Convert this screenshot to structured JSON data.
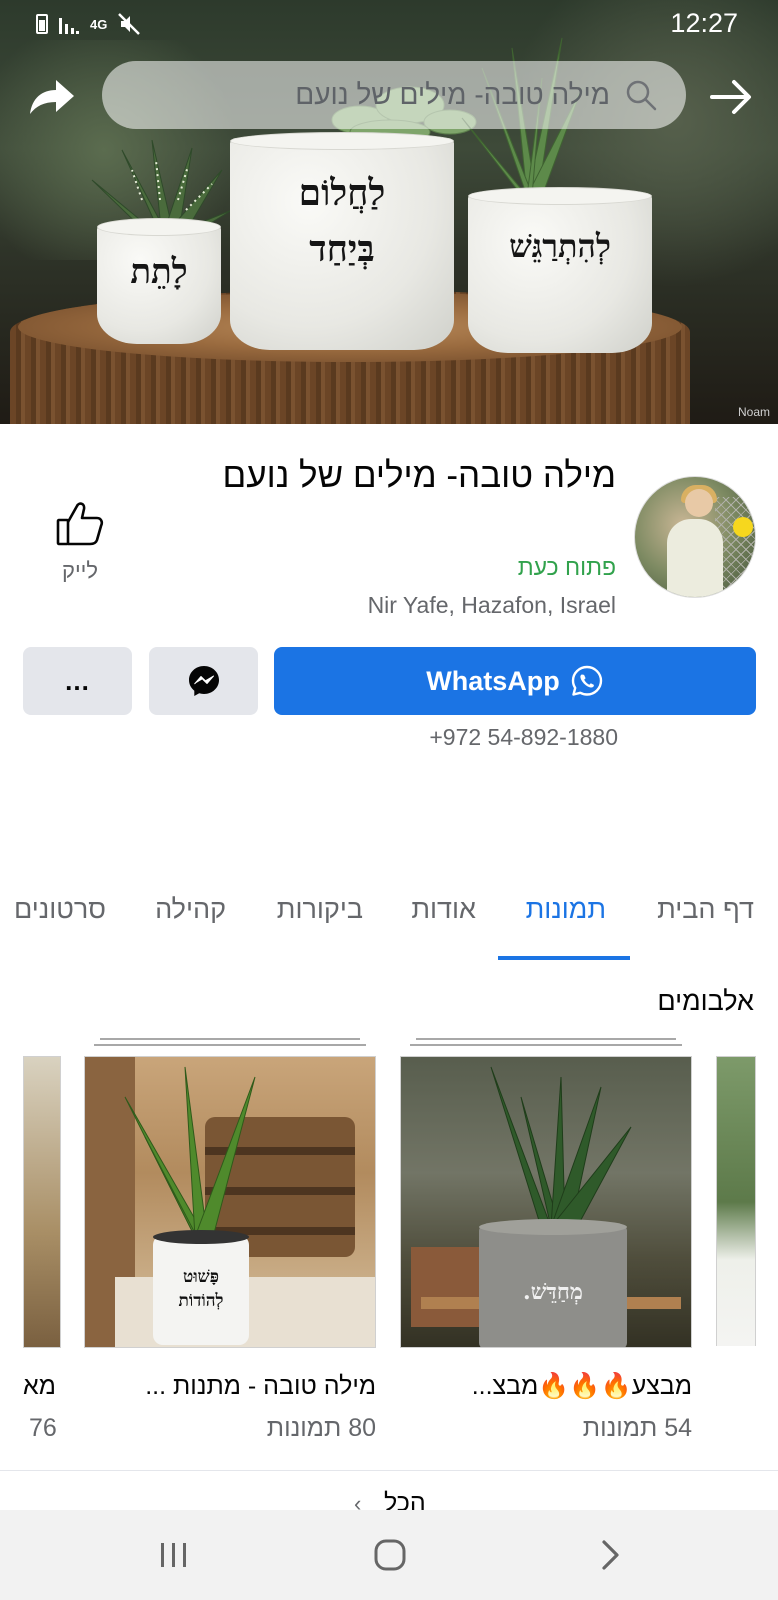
{
  "status_bar": {
    "time": "12:27",
    "network": "4G"
  },
  "top_bar": {
    "search_text": "מילה טובה- מילים של נועם"
  },
  "cover": {
    "pot_left_text": "לָתֵת",
    "pot_center_line1": "לַחֲלוֹם",
    "pot_center_line2": "בְּיַחַד",
    "pot_right_text": "לְהִתְרַגֵּשׁ",
    "watermark": "Noam"
  },
  "profile": {
    "name": "מילה טובה- מילים של נועם",
    "status": "פתוח כעת",
    "location": "Nir Yafe, Hazafon, Israel",
    "like_label": "לייק"
  },
  "actions": {
    "whatsapp_label": "WhatsApp",
    "more_label": "...",
    "phone": "+972 54-892-1880"
  },
  "tabs": [
    {
      "label": "דף הבית",
      "active": false
    },
    {
      "label": "תמונות",
      "active": true
    },
    {
      "label": "אודות",
      "active": false
    },
    {
      "label": "ביקורות",
      "active": false
    },
    {
      "label": "קהילה",
      "active": false
    },
    {
      "label": "סרטונים",
      "active": false
    }
  ],
  "albums": {
    "title": "אלבומים",
    "items": [
      {
        "title": "מבצע🔥🔥🔥מבצ...",
        "count": "54 תמונות",
        "thumb_text": "מְחַדֵּשׁ."
      },
      {
        "title": "מילה טובה - מתנות ...",
        "count": "80 תמונות",
        "thumb_text_line1": "פָּשׁוּט",
        "thumb_text_line2": "לְהוֹדוֹת"
      },
      {
        "title": "מא",
        "count": "76"
      }
    ],
    "see_all_label": "הכל"
  },
  "colors": {
    "brand_blue": "#1b74e4",
    "open_green": "#31a24c",
    "secondary_text": "#65676b",
    "button_gray": "#e4e6eb"
  }
}
